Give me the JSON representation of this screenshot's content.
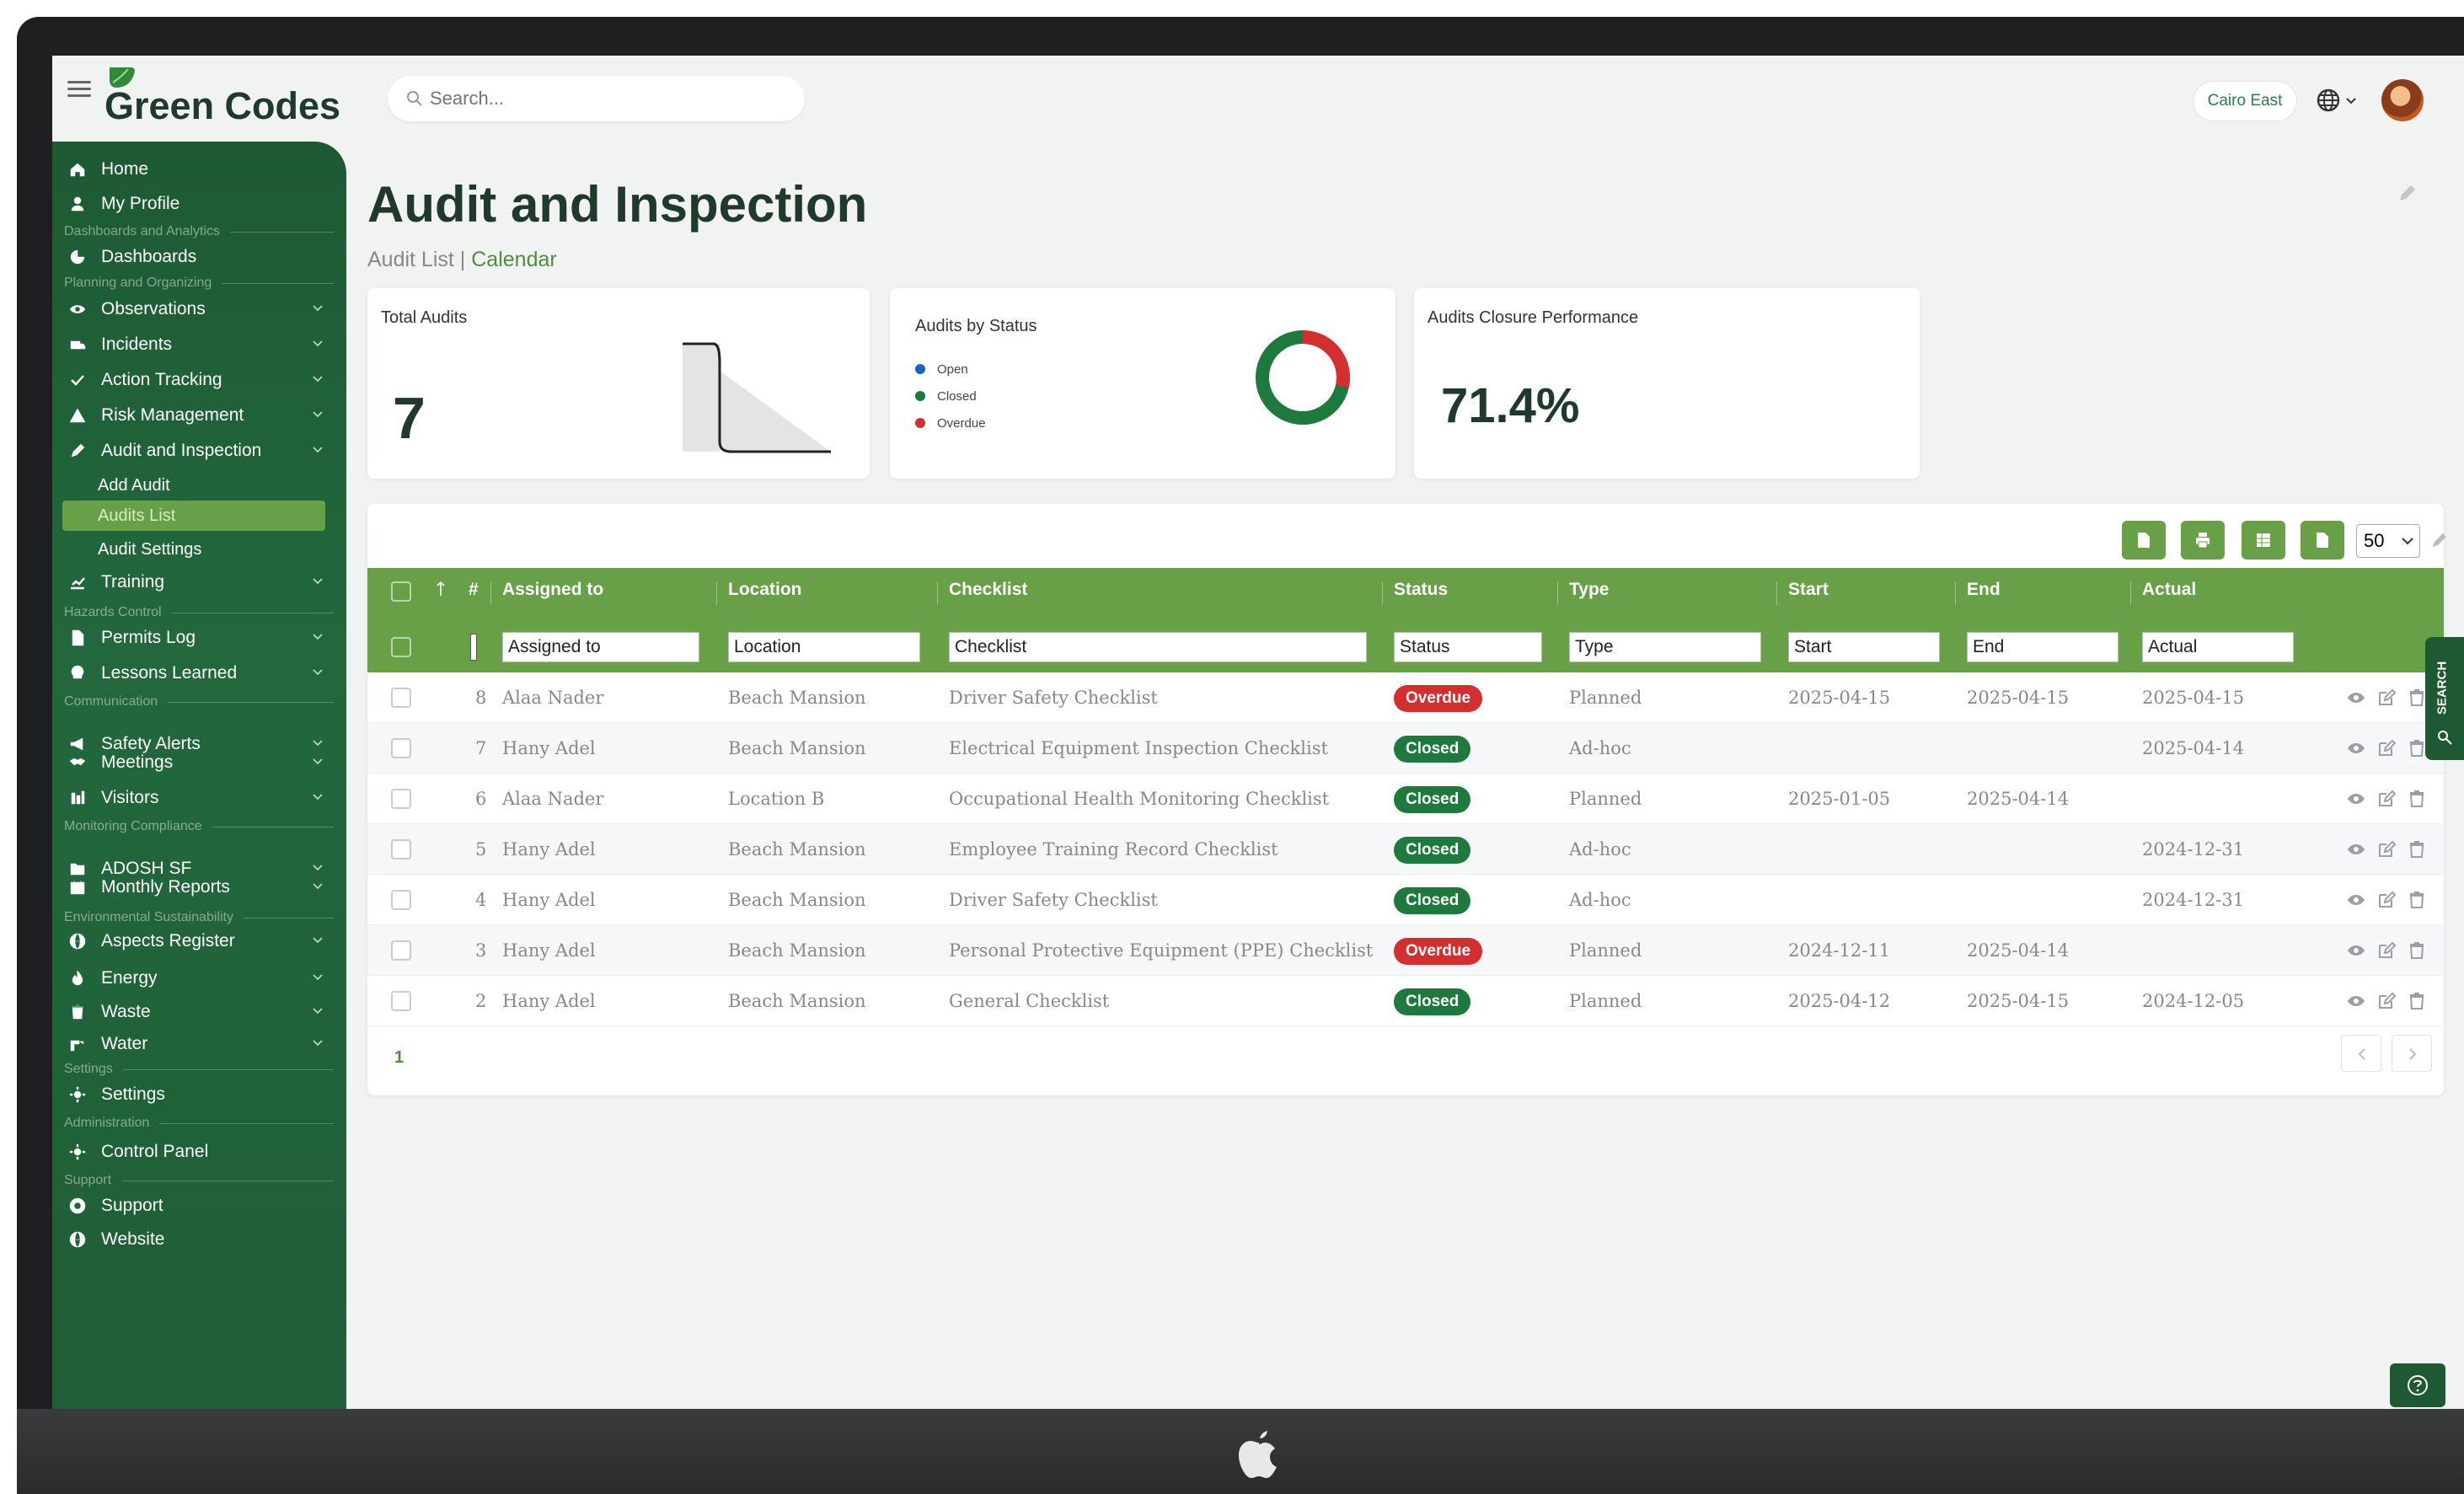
{
  "app": {
    "name": "Green Codes",
    "site": "Cairo East"
  },
  "search": {
    "placeholder": "Search..."
  },
  "sidebar": {
    "items": [
      {
        "label": "Home",
        "icon": "home-icon"
      },
      {
        "label": "My Profile",
        "icon": "user-icon"
      },
      {
        "section": "Dashboards and Analytics"
      },
      {
        "label": "Dashboards",
        "icon": "dashboard-icon"
      },
      {
        "section": "Planning and Organizing"
      },
      {
        "label": "Observations",
        "icon": "eye-icon",
        "expandable": true
      },
      {
        "label": "Incidents",
        "icon": "ambulance-icon",
        "expandable": true
      },
      {
        "label": "Action Tracking",
        "icon": "check-icon",
        "expandable": true
      },
      {
        "label": "Risk Management",
        "icon": "warning-icon",
        "expandable": true
      },
      {
        "label": "Audit and Inspection",
        "icon": "pen-icon",
        "expandable": true
      },
      {
        "sub": "Add Audit"
      },
      {
        "sub": "Audits List",
        "active": true
      },
      {
        "sub": "Audit Settings"
      },
      {
        "label": "Training",
        "icon": "chart-icon",
        "expandable": true
      },
      {
        "section": "Hazards Control"
      },
      {
        "label": "Permits Log",
        "icon": "file-icon",
        "expandable": true
      },
      {
        "label": "Lessons Learned",
        "icon": "bulb-icon",
        "expandable": true
      },
      {
        "section": "Communication"
      },
      {
        "label": "Safety Alerts",
        "icon": "megaphone-icon",
        "expandable": true
      },
      {
        "label": "Meetings",
        "icon": "handshake-icon",
        "expandable": true
      },
      {
        "label": "Visitors",
        "icon": "visitors-icon",
        "expandable": true
      },
      {
        "section": "Monitoring Compliance"
      },
      {
        "label": "ADOSH SF",
        "icon": "folder-icon",
        "expandable": true
      },
      {
        "label": "Monthly Reports",
        "icon": "calendar-icon",
        "expandable": true
      },
      {
        "section": "Environmental Sustainability"
      },
      {
        "label": "Aspects Register",
        "icon": "globe-icon",
        "expandable": true
      },
      {
        "label": "Energy",
        "icon": "flame-icon",
        "expandable": true
      },
      {
        "label": "Waste",
        "icon": "trash-icon",
        "expandable": true
      },
      {
        "label": "Water",
        "icon": "faucet-icon",
        "expandable": true
      },
      {
        "section": "Settings"
      },
      {
        "label": "Settings",
        "icon": "gear-icon"
      },
      {
        "section": "Administration"
      },
      {
        "label": "Control Panel",
        "icon": "gear-icon"
      },
      {
        "section": "Support"
      },
      {
        "label": "Support",
        "icon": "lifebuoy-icon"
      },
      {
        "label": "Website",
        "icon": "globe-icon"
      }
    ]
  },
  "page": {
    "title": "Audit and Inspection",
    "crumb_current": "Audit List",
    "crumb_sep": "|",
    "crumb_link": "Calendar"
  },
  "cards": {
    "total": {
      "title": "Total Audits",
      "value": "7"
    },
    "status": {
      "title": "Audits by Status",
      "legend": [
        "Open",
        "Closed",
        "Overdue"
      ]
    },
    "closure": {
      "title": "Audits Closure Performance",
      "value": "71.4%"
    }
  },
  "colors": {
    "brand": "#1d5a33",
    "header": "#67a047",
    "open": "#1565c0",
    "closed": "#1e7a3c",
    "overdue": "#d32f2f"
  },
  "table": {
    "page_size": "50",
    "columns": [
      "#",
      "Assigned to",
      "Location",
      "Checklist",
      "Status",
      "Type",
      "Start",
      "End",
      "Actual"
    ],
    "filters": [
      "Assigned to",
      "Location",
      "Checklist",
      "Status",
      "Type",
      "Start",
      "End",
      "Actual"
    ],
    "rows": [
      {
        "id": "8",
        "assigned": "Alaa Nader",
        "location": "Beach Mansion",
        "checklist": "Driver Safety Checklist",
        "status": "Overdue",
        "type": "Planned",
        "start": "2025-04-15",
        "end": "2025-04-15",
        "actual": "2025-04-15"
      },
      {
        "id": "7",
        "assigned": "Hany Adel",
        "location": "Beach Mansion",
        "checklist": "Electrical Equipment Inspection Checklist",
        "status": "Closed",
        "type": "Ad-hoc",
        "start": "",
        "end": "",
        "actual": "2025-04-14"
      },
      {
        "id": "6",
        "assigned": "Alaa Nader",
        "location": "Location B",
        "checklist": "Occupational Health Monitoring Checklist",
        "status": "Closed",
        "type": "Planned",
        "start": "2025-01-05",
        "end": "2025-04-14",
        "actual": ""
      },
      {
        "id": "5",
        "assigned": "Hany Adel",
        "location": "Beach Mansion",
        "checklist": "Employee Training Record Checklist",
        "status": "Closed",
        "type": "Ad-hoc",
        "start": "",
        "end": "",
        "actual": "2024-12-31"
      },
      {
        "id": "4",
        "assigned": "Hany Adel",
        "location": "Beach Mansion",
        "checklist": "Driver Safety Checklist",
        "status": "Closed",
        "type": "Ad-hoc",
        "start": "",
        "end": "",
        "actual": "2024-12-31"
      },
      {
        "id": "3",
        "assigned": "Hany Adel",
        "location": "Beach Mansion",
        "checklist": "Personal Protective Equipment (PPE) Checklist",
        "status": "Overdue",
        "type": "Planned",
        "start": "2024-12-11",
        "end": "2025-04-14",
        "actual": ""
      },
      {
        "id": "2",
        "assigned": "Hany Adel",
        "location": "Beach Mansion",
        "checklist": "General Checklist",
        "status": "Closed",
        "type": "Planned",
        "start": "2025-04-12",
        "end": "2025-04-15",
        "actual": "2024-12-05"
      }
    ],
    "current_page": "1"
  },
  "search_tab": {
    "label": "SEARCH"
  }
}
